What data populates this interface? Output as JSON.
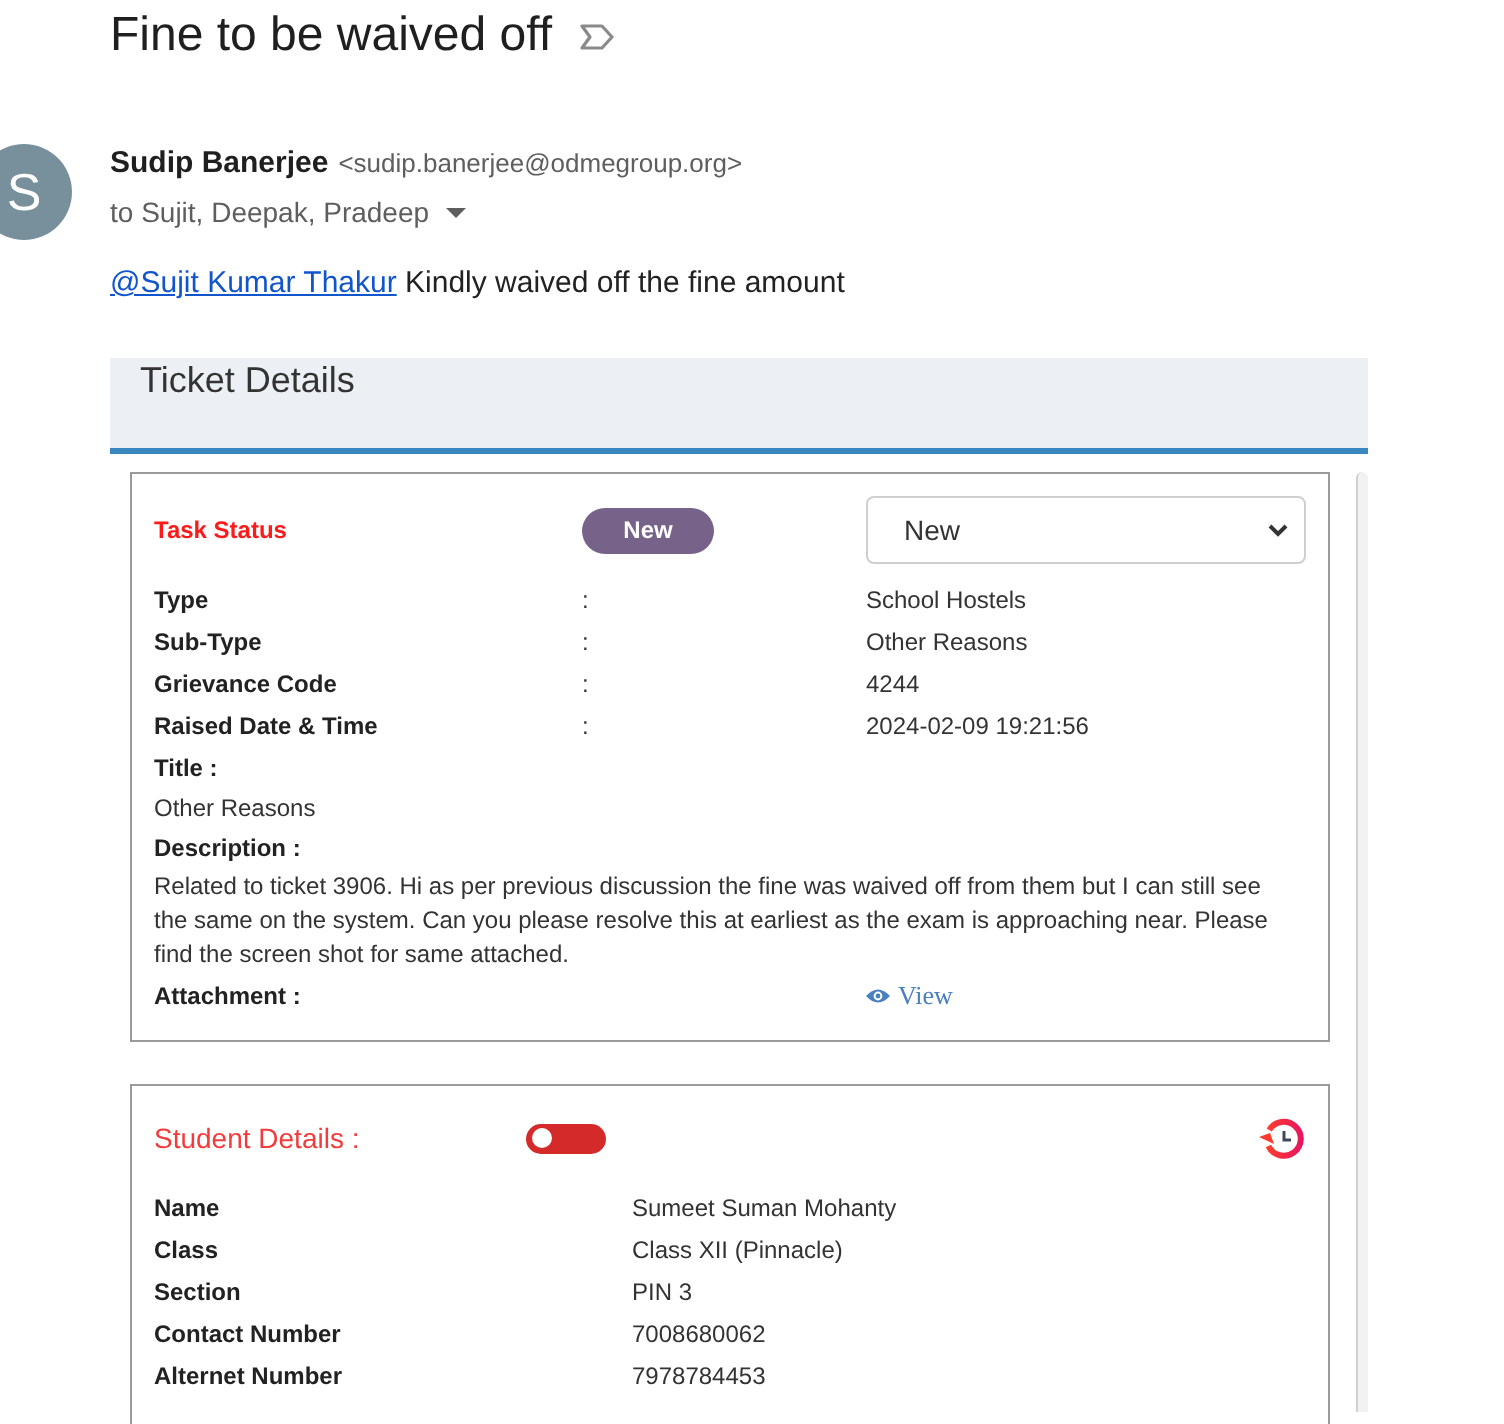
{
  "subject": {
    "title": "Fine to be waived off"
  },
  "message": {
    "avatar_letter": "S",
    "sender_name": "Sudip Banerjee",
    "sender_email": "<sudip.banerjee@odmegroup.org>",
    "recipients": "to Sujit, Deepak, Pradeep",
    "body": {
      "mention": "@Sujit Kumar Thakur",
      "text": "Kindly waived off the fine amount"
    }
  },
  "ticket": {
    "title": "Ticket Details",
    "task_card": {
      "status_label": "Task Status",
      "status_badge": "New",
      "status_select": {
        "value": "New"
      },
      "fields": [
        {
          "label": "Type",
          "separator": ":",
          "value": "School Hostels"
        },
        {
          "label": "Sub-Type",
          "separator": ":",
          "value": "Other Reasons"
        },
        {
          "label": "Grievance Code",
          "separator": ":",
          "value": "4244"
        },
        {
          "label": "Raised Date & Time",
          "separator": ":",
          "value": "2024-02-09 19:21:56"
        }
      ],
      "title_label": "Title :",
      "title_value": "Other Reasons",
      "description_label": "Description :",
      "description": "Related to ticket 3906. Hi as per previous discussion the fine was waived off from them but I can still see the same on the system. Can you please resolve this at earliest as the exam is approaching near. Please find the screen shot for same attached.",
      "attachment_label": "Attachment :",
      "attachment_link": "View"
    },
    "student_card": {
      "title": "Student Details :",
      "toggle": {
        "on": false
      },
      "fields": [
        {
          "label": "Name",
          "value": "Sumeet Suman Mohanty"
        },
        {
          "label": "Class",
          "value": "Class XII (Pinnacle)"
        },
        {
          "label": "Section",
          "value": "PIN 3"
        },
        {
          "label": "Contact Number",
          "value": "7008680062"
        },
        {
          "label": "Alternet Number",
          "value": "7978784453"
        }
      ]
    }
  }
}
